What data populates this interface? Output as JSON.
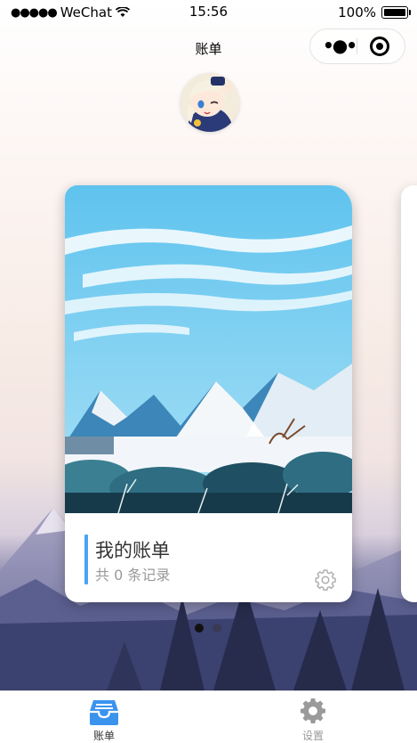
{
  "status_bar": {
    "carrier": "WeChat",
    "time": "15:56",
    "battery": "100%"
  },
  "nav": {
    "title": "账单"
  },
  "cards": [
    {
      "title": "我的账单",
      "subtitle": "共 0 条记录"
    }
  ],
  "pager": {
    "count": 2,
    "active": 0
  },
  "tabbar": {
    "items": [
      {
        "label": "账单",
        "icon": "inbox-icon",
        "active": true,
        "color": "#3b93ee"
      },
      {
        "label": "设置",
        "icon": "gear-icon",
        "active": false,
        "color": "#999999"
      }
    ]
  },
  "colors": {
    "accent": "#4da3f4",
    "tab_active": "#333333",
    "tab_inactive": "#999999"
  }
}
